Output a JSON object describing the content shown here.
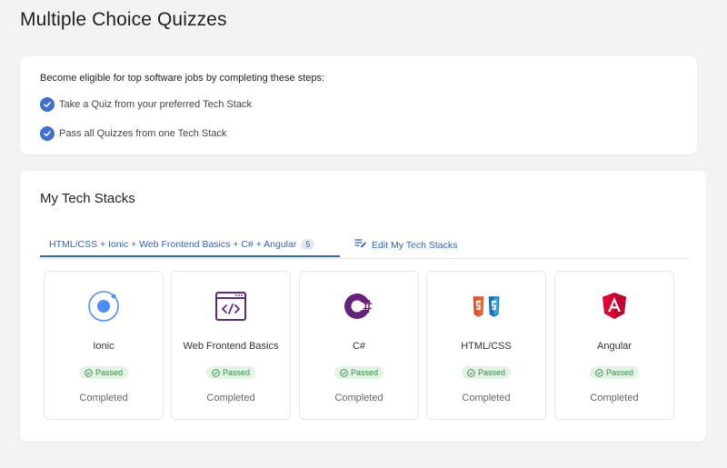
{
  "page": {
    "title": "Multiple Choice Quizzes"
  },
  "steps": {
    "intro": "Become eligible for top software jobs by completing these steps:",
    "items": [
      {
        "label": "Take a Quiz from your preferred Tech Stack",
        "done": true
      },
      {
        "label": "Pass all Quizzes from one Tech Stack",
        "done": true
      }
    ]
  },
  "stacks_section": {
    "title": "My Tech Stacks",
    "active_tab": {
      "label": "HTML/CSS + Ionic + Web Frontend Basics + C# + Angular",
      "count": "5"
    },
    "edit_tab": {
      "label": "Edit My Tech Stacks",
      "icon": "edit-list-icon"
    },
    "items": [
      {
        "name": "Ionic",
        "badge": "Passed",
        "status": "Completed",
        "icon": "ionic-icon"
      },
      {
        "name": "Web Frontend Basics",
        "badge": "Passed",
        "status": "Completed",
        "icon": "code-window-icon"
      },
      {
        "name": "C#",
        "badge": "Passed",
        "status": "Completed",
        "icon": "csharp-icon"
      },
      {
        "name": "HTML/CSS",
        "badge": "Passed",
        "status": "Completed",
        "icon": "html-css-icon"
      },
      {
        "name": "Angular",
        "badge": "Passed",
        "status": "Completed",
        "icon": "angular-icon"
      }
    ]
  },
  "colors": {
    "accent": "#2f64c9",
    "check": "#3f6fd1",
    "passed_bg": "#e3f4e6",
    "passed_text": "#3a8a48",
    "page_bg": "#f3f3f3"
  }
}
